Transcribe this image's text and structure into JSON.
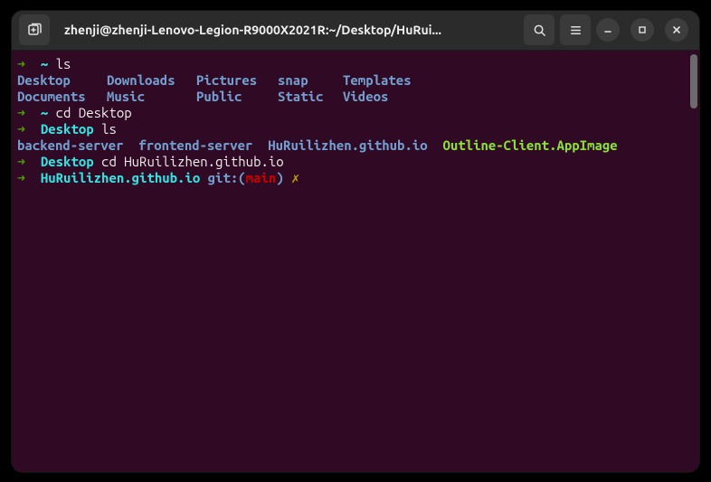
{
  "titlebar": {
    "title": "zhenji@zhenji-Lenovo-Legion-R9000X2021R:~/Desktop/HuRui..."
  },
  "prompt": {
    "arrow": "➜",
    "home": "~",
    "desktop": "Desktop",
    "repo": "HuRuilizhen.github.io",
    "git_label": "git:",
    "git_open": "(",
    "git_branch": "main",
    "git_close": ")",
    "dirty": "✗"
  },
  "commands": {
    "ls": "ls",
    "cd_desktop": "cd Desktop",
    "cd_repo": "cd HuRuilizhen.github.io"
  },
  "ls_home": {
    "r1c1": "Desktop",
    "r1c2": "Downloads",
    "r1c3": "Pictures",
    "r1c4": "snap",
    "r1c5": "Templates",
    "r2c1": "Documents",
    "r2c2": "Music",
    "r2c3": "Public",
    "r2c4": "Static",
    "r2c5": "Videos"
  },
  "ls_desktop": {
    "c1": "backend-server",
    "c2": "frontend-server",
    "c3": "HuRuilizhen.github.io",
    "c4": "Outline-Client.AppImage"
  }
}
